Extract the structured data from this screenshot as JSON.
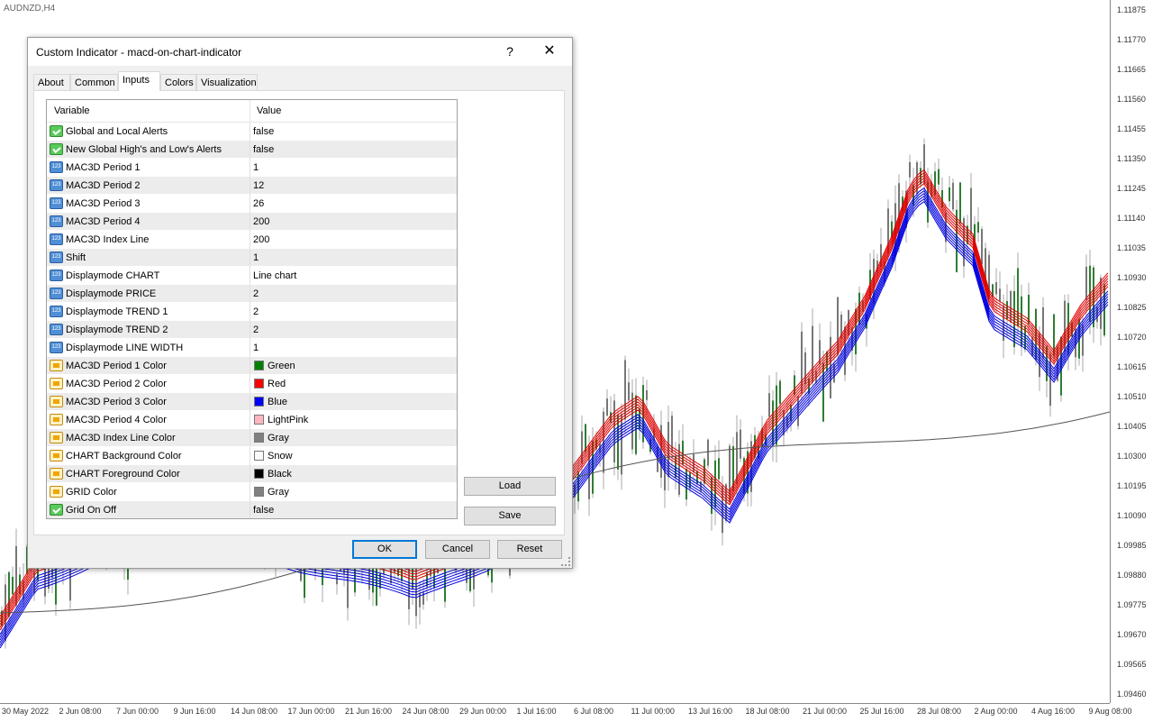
{
  "chart": {
    "symbol": "AUDNZD,H4",
    "price_labels": [
      "1.11875",
      "1.11770",
      "1.11665",
      "1.11560",
      "1.11455",
      "1.11350",
      "1.11245",
      "1.11140",
      "1.11035",
      "1.10930",
      "1.10825",
      "1.10720",
      "1.10615",
      "1.10510",
      "1.10405",
      "1.10300",
      "1.10195",
      "1.10090",
      "1.09985",
      "1.09880",
      "1.09775",
      "1.09670",
      "1.09565",
      "1.09460"
    ],
    "date_labels": [
      "30 May 2022",
      "2 Jun 08:00",
      "7 Jun 00:00",
      "9 Jun 16:00",
      "14 Jun 08:00",
      "17 Jun 00:00",
      "21 Jun 16:00",
      "24 Jun 08:00",
      "29 Jun 00:00",
      "1 Jul 16:00",
      "6 Jul 08:00",
      "11 Jul 00:00",
      "13 Jul 16:00",
      "18 Jul 08:00",
      "21 Jul 00:00",
      "25 Jul 16:00",
      "28 Jul 08:00",
      "2 Aug 00:00",
      "4 Aug 16:00",
      "9 Aug 08:00"
    ]
  },
  "dialog": {
    "title": "Custom Indicator - macd-on-chart-indicator",
    "help": "?",
    "close": "✕",
    "tabs": [
      "About",
      "Common",
      "Inputs",
      "Colors",
      "Visualization"
    ],
    "active_tab": "Inputs",
    "grid": {
      "col_variable": "Variable",
      "col_value": "Value",
      "rows": [
        {
          "icon": "bool",
          "variable": "Global and Local Alerts",
          "value": "false"
        },
        {
          "icon": "bool",
          "variable": "New Global High's and Low's Alerts",
          "value": "false"
        },
        {
          "icon": "num",
          "variable": "MAC3D Period 1",
          "value": "1"
        },
        {
          "icon": "num",
          "variable": "MAC3D Period 2",
          "value": "12"
        },
        {
          "icon": "num",
          "variable": "MAC3D Period 3",
          "value": "26"
        },
        {
          "icon": "num",
          "variable": "MAC3D Period 4",
          "value": "200"
        },
        {
          "icon": "num",
          "variable": "MAC3D Index Line",
          "value": "200"
        },
        {
          "icon": "num",
          "variable": "Shift",
          "value": "1"
        },
        {
          "icon": "num",
          "variable": "Displaymode CHART",
          "value": "Line chart"
        },
        {
          "icon": "num",
          "variable": "Displaymode PRICE",
          "value": "2"
        },
        {
          "icon": "num",
          "variable": "Displaymode TREND 1",
          "value": "2"
        },
        {
          "icon": "num",
          "variable": "Displaymode TREND 2",
          "value": "2"
        },
        {
          "icon": "num",
          "variable": "Displaymode LINE WIDTH",
          "value": "1"
        },
        {
          "icon": "color",
          "variable": "MAC3D Period 1 Color",
          "value": "Green",
          "swatch": "#008000"
        },
        {
          "icon": "color",
          "variable": "MAC3D Period 2 Color",
          "value": "Red",
          "swatch": "#ff0000"
        },
        {
          "icon": "color",
          "variable": "MAC3D Period 3 Color",
          "value": "Blue",
          "swatch": "#0000ff"
        },
        {
          "icon": "color",
          "variable": "MAC3D Period 4 Color",
          "value": "LightPink",
          "swatch": "#ffb6c1"
        },
        {
          "icon": "color",
          "variable": "MAC3D Index Line Color",
          "value": "Gray",
          "swatch": "#808080"
        },
        {
          "icon": "color",
          "variable": "CHART Background Color",
          "value": "Snow",
          "swatch": "#fffafa"
        },
        {
          "icon": "color",
          "variable": "CHART Foreground Color",
          "value": "Black",
          "swatch": "#000000"
        },
        {
          "icon": "color",
          "variable": "GRID Color",
          "value": "Gray",
          "swatch": "#808080"
        },
        {
          "icon": "bool",
          "variable": "Grid On Off",
          "value": "false"
        }
      ]
    },
    "load_label": "Load",
    "save_label": "Save",
    "ok_label": "OK",
    "cancel_label": "Cancel",
    "reset_label": "Reset"
  }
}
